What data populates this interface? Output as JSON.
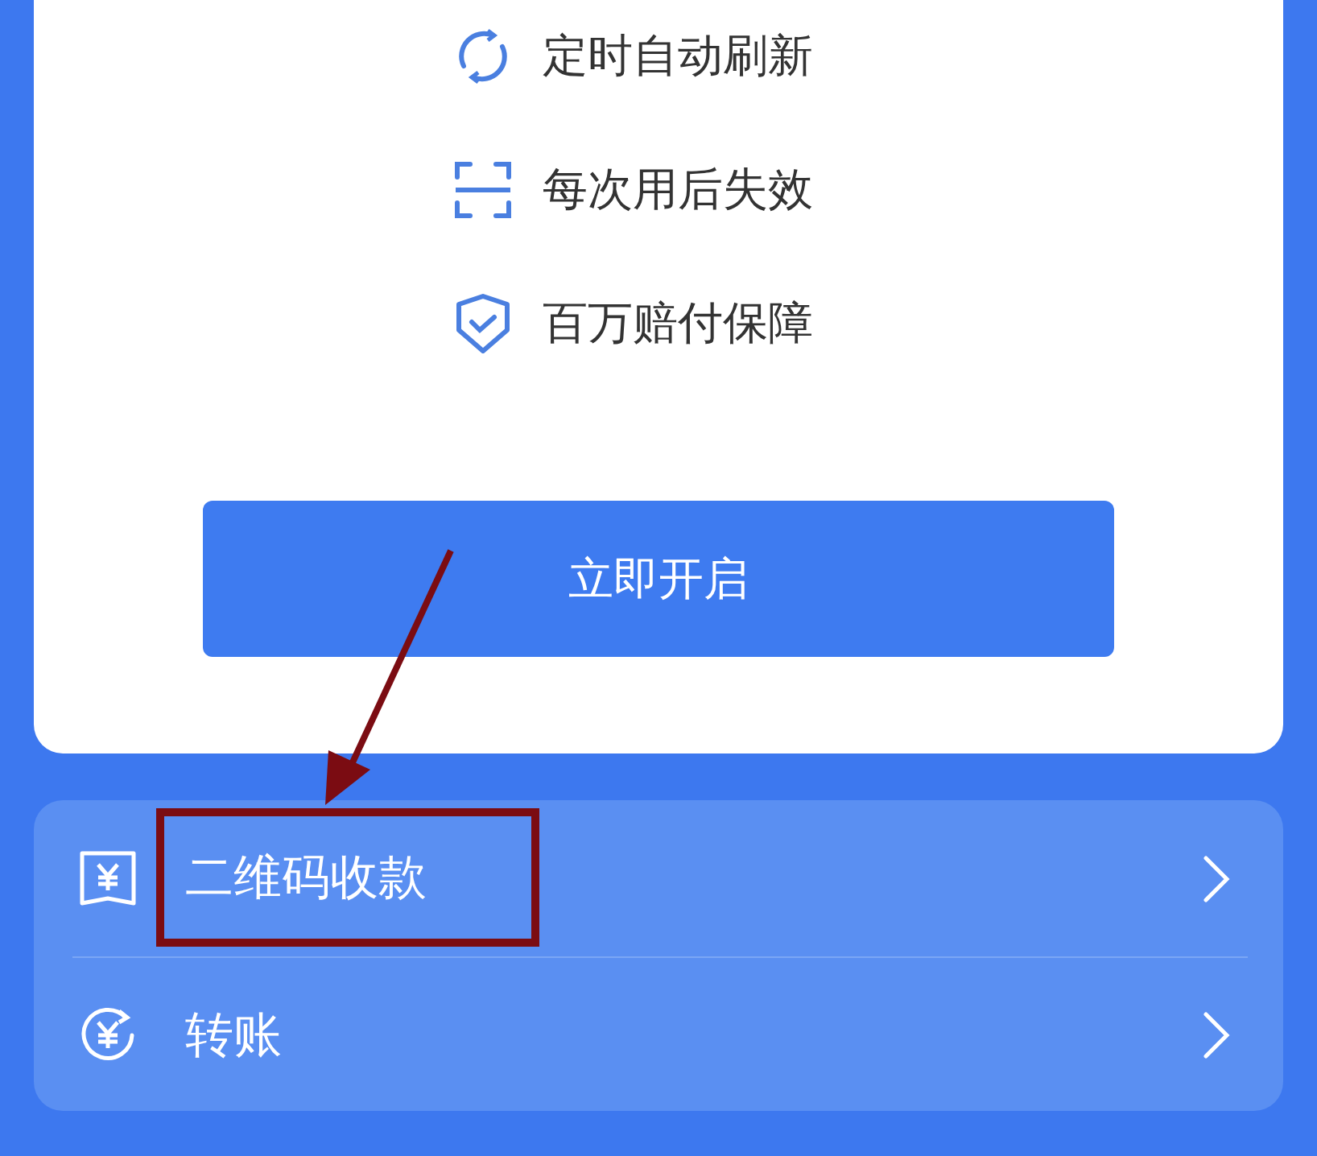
{
  "features": [
    {
      "kind": "refresh",
      "label": "定时自动刷新"
    },
    {
      "kind": "scan",
      "label": "每次用后失效"
    },
    {
      "kind": "shield",
      "label": "百万赔付保障"
    }
  ],
  "primary_button": {
    "label": "立即开启"
  },
  "menu": [
    {
      "kind": "qr-receipt",
      "label": "二维码收款",
      "annotated": true
    },
    {
      "kind": "transfer",
      "label": "转账",
      "annotated": false
    }
  ]
}
